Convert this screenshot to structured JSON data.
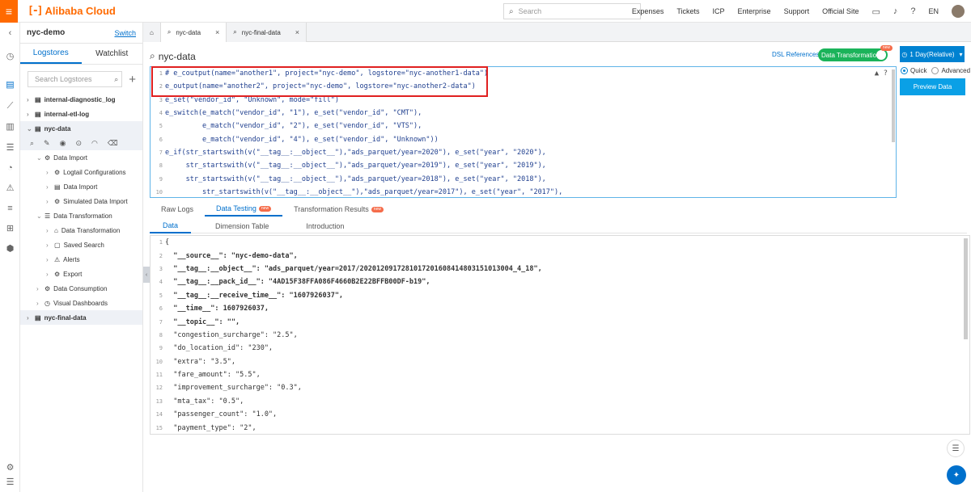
{
  "brand": "Alibaba Cloud",
  "search": {
    "placeholder": "Search"
  },
  "topnav": [
    "Expenses",
    "Tickets",
    "ICP",
    "Enterprise",
    "Support",
    "Official Site"
  ],
  "lang": "EN",
  "sidebar": {
    "project": "nyc-demo",
    "switch_label": "Switch",
    "tabs": [
      "Logstores",
      "Watchlist"
    ],
    "search_placeholder": "Search Logstores",
    "tree": [
      {
        "label": "internal-diagnostic_log",
        "level": 0,
        "bold": true
      },
      {
        "label": "internal-etl-log",
        "level": 0,
        "bold": true
      },
      {
        "label": "nyc-data",
        "level": 0,
        "bold": true,
        "open": true
      },
      {
        "label": "Data Import",
        "level": 1
      },
      {
        "label": "Logtail Configurations",
        "level": 2
      },
      {
        "label": "Data Import",
        "level": 2
      },
      {
        "label": "Simulated Data Import",
        "level": 2
      },
      {
        "label": "Data Transformation",
        "level": 1
      },
      {
        "label": "Data Transformation",
        "level": 2
      },
      {
        "label": "Saved Search",
        "level": 2
      },
      {
        "label": "Alerts",
        "level": 2
      },
      {
        "label": "Export",
        "level": 2
      },
      {
        "label": "Data Consumption",
        "level": 1
      },
      {
        "label": "Visual Dashboards",
        "level": 1
      },
      {
        "label": "nyc-final-data",
        "level": 0,
        "bold": true
      }
    ]
  },
  "tabs": [
    "nyc-data",
    "nyc-final-data"
  ],
  "main": {
    "title": "nyc-data",
    "dsl_ref": "DSL References",
    "dt_label": "Data Transformation",
    "new_badge": "new",
    "day_label": "1 Day(Relative)",
    "quick": "Quick",
    "advanced": "Advanced",
    "preview": "Preview Data"
  },
  "code": [
    "# e_coutput(name=\"another1\", project=\"nyc-demo\", logstore=\"nyc-another1-data\")",
    "e_output(name=\"another2\", project=\"nyc-demo\", logstore=\"nyc-another2-data\")",
    "e_set(\"vendor_id\", \"Unknown\", mode=\"fill\")",
    "e_switch(e_match(\"vendor_id\", \"1\"), e_set(\"vendor_id\", \"CMT\"),",
    "         e_match(\"vendor_id\", \"2\"), e_set(\"vendor_id\", \"VTS\"),",
    "         e_match(\"vendor_id\", \"4\"), e_set(\"vendor_id\", \"Unknown\"))",
    "e_if(str_startswith(v(\"__tag__:__object__\"),\"ads_parquet/year=2020\"), e_set(\"year\", \"2020\"),",
    "     str_startswith(v(\"__tag__:__object__\"),\"ads_parquet/year=2019\"), e_set(\"year\", \"2019\"),",
    "     str_startswith(v(\"__tag__:__object__\"),\"ads_parquet/year=2018\"), e_set(\"year\", \"2018\"),",
    "         str_startswith(v(\"__tag__:__object__\"),\"ads_parquet/year=2017\"), e_set(\"year\", \"2017\"),"
  ],
  "bottom_tabs": [
    "Raw Logs",
    "Data Testing",
    "Transformation Results"
  ],
  "sub_tabs": [
    "Data",
    "Dimension Table",
    "Introduction"
  ],
  "json_lines": [
    "{",
    "  \"__source__\": \"nyc-demo-data\",",
    "  \"__tag__:__object__\": \"ads_parquet/year=2017/20201209172810172016084148031510130​04_4_18\",",
    "  \"__tag__:__pack_id__\": \"4AD15F38FFA086F4660B2E22BFFB00DF-b19\",",
    "  \"__tag__:__receive_time__\": \"1607926037\",",
    "  \"__time__\": 1607926037,",
    "  \"__topic__\": \"\",",
    "  \"congestion_surcharge\": \"2.5\",",
    "  \"do_location_id\": \"230\",",
    "  \"extra\": \"3.5\",",
    "  \"fare_amount\": \"5.5\",",
    "  \"improvement_surcharge\": \"0.3\",",
    "  \"mta_tax\": \"0.5\",",
    "  \"passenger_count\": \"1.0\",",
    "  \"payment_type\": \"2\","
  ]
}
